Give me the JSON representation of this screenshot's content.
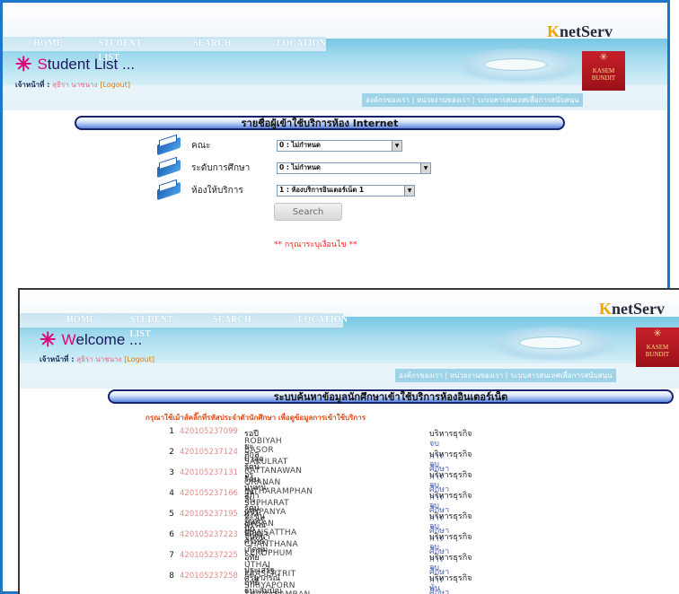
{
  "back_window": {
    "nav": [
      "HOME",
      "STUDENT LIST",
      "SEARCH",
      "LOCATION"
    ],
    "brand_initial": "K",
    "brand_rest": "netServ",
    "title_initial": "S",
    "title_rest": "tudent List ...",
    "staff_label": "เจ้าหน้าที่ :",
    "staff_name": "สุธิรา นาชนาง",
    "logout": "[Logout]",
    "logo_text_1": "KASEM",
    "logo_text_2": "BUNDIT",
    "sublinks": "องค์กรของเรา  |  หน่วยงานของเรา  |  ระบบสารสนเทศเพื่อการสนับสนุน",
    "section_title": "รายชื่อผู้เข้าใช้บริการห้อง Internet",
    "form": {
      "faculty_label": "คณะ",
      "faculty_value": "0 : ไม่กำหนด",
      "level_label": "ระดับการศึกษา",
      "level_value": "0 : ไม่กำหนด",
      "room_label": "ห้องให้บริการ",
      "room_value": "1 : ห้องบริการอินเตอร์เน็ต 1",
      "search_button": "Search",
      "warning": "** กรุณาระบุเงื่อนไข **"
    }
  },
  "front_window": {
    "nav": [
      "HOME",
      "STUDENT LIST",
      "SEARCH",
      "LOCATION"
    ],
    "brand_initial": "K",
    "brand_rest": "netServ",
    "title_initial": "W",
    "title_rest": "elcome ...",
    "staff_label": "เจ้าหน้าที่ :",
    "staff_name": "สุธิรา นาชนาง",
    "logout": "[Logout]",
    "logo_text_1": "KASEM",
    "logo_text_2": "BUNDIT",
    "sublinks": "องค์กรของเรา  |  หน่วยงานของเรา  |  ระบบสารสนเทศเพื่อการสนับสนุน",
    "section_title": "ระบบค้นหาข้อมูลนักศึกษาเข้าใช้บริการห้องอินเตอร์เน็ต",
    "instruction": "กรุณาใช้เม้าส์คลิ๊กที่รหัสประจำตัวนักศึกษา เพื่อดูข้อมูลการเข้าใช้บริการ",
    "students": [
      {
        "no": "1",
        "id": "420105237099",
        "name_th": "รอปียะ บาสอ",
        "name_en": "ROBIYAH BASOR",
        "faculty": "บริหารธุรกิจ",
        "dept": "จบการศึกษา"
      },
      {
        "no": "2",
        "id": "420105237124",
        "name_th": "สกุลรัตน์ รัตนวัน",
        "name_en": "SAKULRAT RATTANAWAN",
        "faculty": "บริหารธุรกิจ",
        "dept": "จบการศึกษา"
      },
      {
        "no": "3",
        "id": "420105237131",
        "name_th": "อรนันทน์ อินทรำพรรณ",
        "name_en": "ORANAN INTHARAMPHAN",
        "faculty": "บริหารธุรกิจ",
        "dept": "จบการศึกษา"
      },
      {
        "no": "4",
        "id": "420105237166",
        "name_th": "สุภารัตน์ จันทร์ปัญญา",
        "name_en": "SUPHARAT JANPANYA",
        "faculty": "บริหารธุรกิจ",
        "dept": "จบการศึกษา"
      },
      {
        "no": "5",
        "id": "420105237195",
        "name_th": "หะซัน มันศรัทธา",
        "name_en": "HASAN MANSATTHA",
        "faculty": "บริหารธุรกิจ",
        "dept": "จบการศึกษา"
      },
      {
        "no": "6",
        "id": "420105237223",
        "name_th": "จันทนา เกิดพุ่ม",
        "name_en": "CHANTHANA KERDPHUM",
        "faculty": "บริหารธุรกิจ",
        "dept": "จบการศึกษา"
      },
      {
        "no": "7",
        "id": "420105237225",
        "name_th": "อุทัย ประเสริฐฤทธิ์",
        "name_en": "UTHAI PRASERTRIT",
        "faculty": "บริหารธุรกิจ",
        "dept": "จบการศึกษา"
      },
      {
        "no": "8",
        "id": "420105237258",
        "name_th": "ศิริยาภรณ์ ธนะสัมบัญ",
        "name_en": "SIRIYAPORN THANASAMBAN",
        "faculty": "บริหารธุรกิจ",
        "dept": "พ้นสภาพ"
      }
    ]
  },
  "colors": {
    "border_blue": "#2077c8",
    "accent_pink": "#e0007a",
    "brand_gold": "#f0a400",
    "id_link": "#e98a8a",
    "section_bar": "#5d86e0"
  }
}
